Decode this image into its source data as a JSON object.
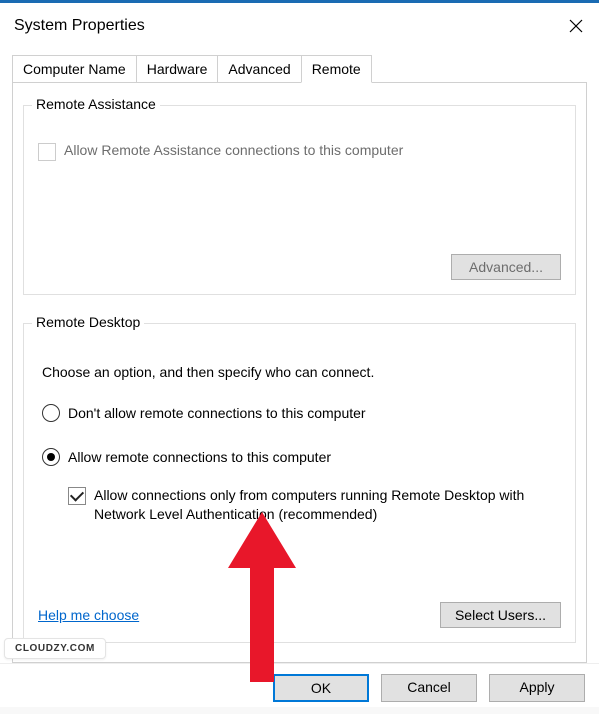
{
  "window": {
    "title": "System Properties"
  },
  "tabs": {
    "items": [
      "Computer Name",
      "Hardware",
      "Advanced",
      "Remote"
    ],
    "activeIndex": 3
  },
  "remoteAssistance": {
    "groupTitle": "Remote Assistance",
    "checkboxLabel": "Allow Remote Assistance connections to this computer",
    "checked": false,
    "advancedButton": "Advanced..."
  },
  "remoteDesktop": {
    "groupTitle": "Remote Desktop",
    "instruction": "Choose an option, and then specify who can connect.",
    "options": {
      "deny": "Don't allow remote connections to this computer",
      "allow": "Allow remote connections to this computer"
    },
    "selected": "allow",
    "nlaChecked": true,
    "nlaLabel": "Allow connections only from computers running Remote Desktop with Network Level Authentication (recommended)",
    "helpLink": "Help me choose",
    "selectUsersButton": "Select Users..."
  },
  "footer": {
    "ok": "OK",
    "cancel": "Cancel",
    "apply": "Apply"
  },
  "badge": "CLOUDZY.COM"
}
